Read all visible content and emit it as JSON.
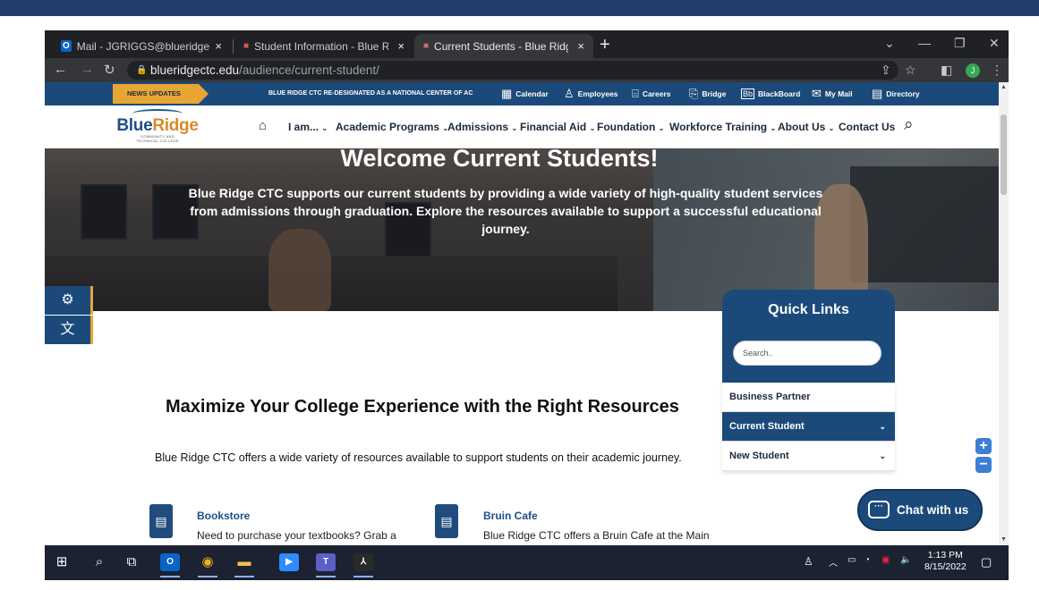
{
  "browser": {
    "tabs": [
      {
        "icon": "outlook",
        "label": "Mail - JGRIGGS@blueridgectc.edu",
        "close": "×"
      },
      {
        "icon": "student",
        "label": "Student Information - Blue Ridge",
        "close": "×"
      },
      {
        "icon": "bb",
        "label": "Current Students - Blue Ridge Co",
        "close": "×"
      }
    ],
    "new_tab": "+",
    "url_domain": "blueridgectc.edu",
    "url_path": "/audience/current-student/",
    "avatar_letter": "J"
  },
  "utility_bar": {
    "news_label": "NEWS UPDATES",
    "news_ticker": "BLUE RIDGE CTC RE-DESIGNATED AS A NATIONAL CENTER OF AC",
    "links": [
      {
        "label": "Calendar",
        "icon": "calendar-icon"
      },
      {
        "label": "Employees",
        "icon": "person-icon"
      },
      {
        "label": "Careers",
        "icon": "briefcase-icon"
      },
      {
        "label": "Bridge",
        "icon": "bridge-icon"
      },
      {
        "label": "BlackBoard",
        "icon": "blackboard-icon"
      },
      {
        "label": "My Mail",
        "icon": "mail-icon"
      },
      {
        "label": "Directory",
        "icon": "directory-icon"
      }
    ]
  },
  "logo": {
    "part1": "Blue",
    "part2": "Ridge",
    "sub1": "COMMUNITY AND",
    "sub2": "TECHNICAL COLLEGE"
  },
  "nav": [
    "I am...",
    "Academic Programs",
    "Admissions",
    "Financial Aid",
    "Foundation",
    "Workforce Training",
    "About Us",
    "Contact Us"
  ],
  "hero": {
    "title": "Welcome Current Students!",
    "text": "Blue Ridge CTC supports our current students by providing a wide variety of high-quality student services from admissions through graduation. Explore the resources available to support a successful educational journey."
  },
  "quick_links": {
    "title": "Quick Links",
    "search_placeholder": "Search..",
    "items": [
      {
        "label": "Business Partner",
        "selected": false,
        "expandable": false
      },
      {
        "label": "Current Student",
        "selected": true,
        "expandable": true
      },
      {
        "label": "New Student",
        "selected": false,
        "expandable": true
      }
    ]
  },
  "section": {
    "title": "Maximize Your College Experience with the Right Resources",
    "text": "Blue Ridge CTC offers a wide variety of resources available to support students on their academic journey."
  },
  "resources": [
    {
      "title": "Bookstore",
      "desc": "Need to purchase your textbooks? Grab a"
    },
    {
      "title": "Bruin Cafe",
      "desc": "Blue Ridge CTC offers a Bruin Cafe at the Main"
    }
  ],
  "chat": {
    "label": "Chat with us"
  },
  "taskbar": {
    "time": "1:13 PM",
    "date": "8/15/2022"
  },
  "colors": {
    "brand_blue": "#1b4a7a",
    "accent_gold": "#e7a634",
    "chrome_dark": "#202124"
  }
}
